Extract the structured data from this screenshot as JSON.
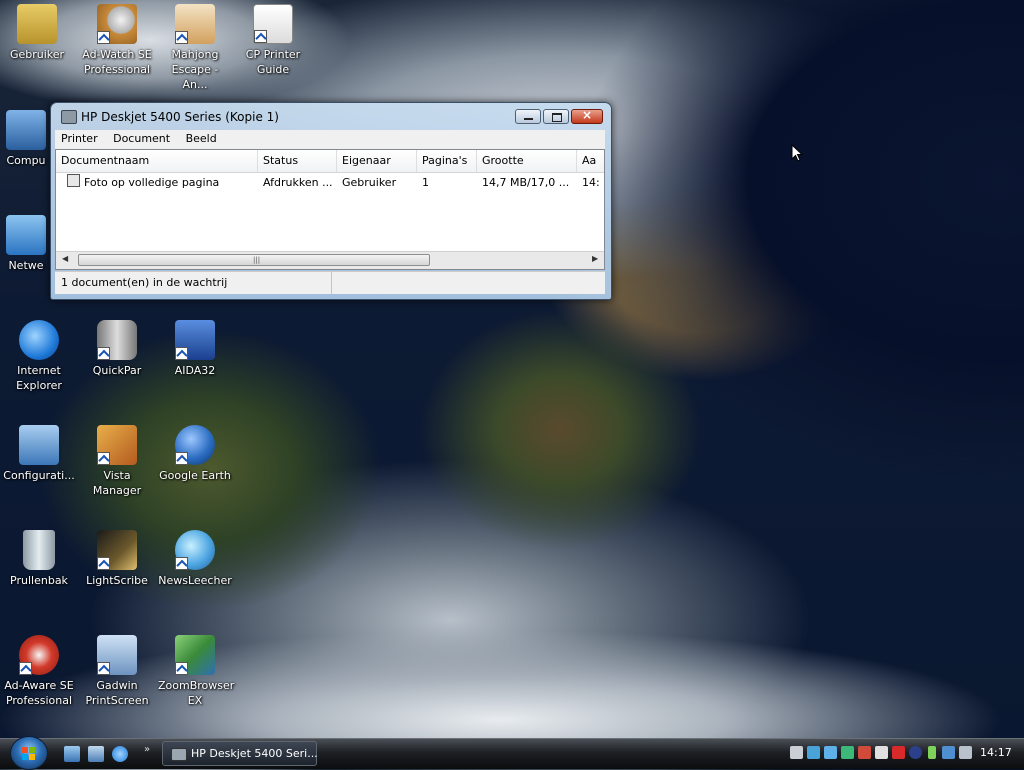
{
  "desktop": {
    "icons": [
      {
        "id": "gebruiker",
        "label": "Gebruiker",
        "color": "#d7b74a",
        "shortcut": false
      },
      {
        "id": "adwatch",
        "label": "Ad-Watch SE Professional",
        "color": "#c98b3a",
        "shortcut": true
      },
      {
        "id": "mahjong",
        "label": "Mahjong Escape - An...",
        "color": "#b8482f",
        "shortcut": true
      },
      {
        "id": "cpprinter",
        "label": "CP Printer Guide",
        "color": "#e6e6e6",
        "shortcut": true
      },
      {
        "id": "computer",
        "label": "Compu",
        "color": "#3f7fc9",
        "shortcut": false
      },
      {
        "id": "network",
        "label": "Netwe",
        "color": "#3a8bd6",
        "shortcut": false
      },
      {
        "id": "ie",
        "label": "Internet Explorer",
        "color": "#1f7ad8",
        "shortcut": false
      },
      {
        "id": "quickpar",
        "label": "QuickPar",
        "color": "#9ea4aa",
        "shortcut": true
      },
      {
        "id": "aida32",
        "label": "AIDA32",
        "color": "#2857b8",
        "shortcut": true
      },
      {
        "id": "config",
        "label": "Configurati...",
        "color": "#4e8ecf",
        "shortcut": false
      },
      {
        "id": "vista",
        "label": "Vista Manager",
        "color": "#d9892d",
        "shortcut": true
      },
      {
        "id": "gearth",
        "label": "Google Earth",
        "color": "#2b6dc2",
        "shortcut": true
      },
      {
        "id": "recycle",
        "label": "Prullenbak",
        "color": "#b4c2cc",
        "shortcut": false
      },
      {
        "id": "lightscribe",
        "label": "LightScribe",
        "color": "#6d5a2c",
        "shortcut": true
      },
      {
        "id": "newsleecher",
        "label": "NewsLeecher",
        "color": "#4ea6e2",
        "shortcut": true
      },
      {
        "id": "adaware",
        "label": "Ad-Aware SE Professional",
        "color": "#d23a2a",
        "shortcut": true
      },
      {
        "id": "gadwin",
        "label": "Gadwin PrintScreen",
        "color": "#7ea6d4",
        "shortcut": true
      },
      {
        "id": "zoombrowser",
        "label": "ZoomBrowser EX",
        "color": "#4fa04a",
        "shortcut": true
      }
    ]
  },
  "window": {
    "title": "HP Deskjet 5400 Series (Kopie 1)",
    "menu": [
      "Printer",
      "Document",
      "Beeld"
    ],
    "columns": [
      "Documentnaam",
      "Status",
      "Eigenaar",
      "Pagina's",
      "Grootte",
      "Aa"
    ],
    "rows": [
      {
        "name": "Foto op volledige pagina",
        "status": "Afdrukken ...",
        "owner": "Gebruiker",
        "pages": "1",
        "size": "14,7 MB/17,0 ...",
        "extra": "14:"
      }
    ],
    "status_text": "1 document(en) in de wachtrij",
    "close_glyph": "×"
  },
  "taskbar": {
    "task_label": "HP Deskjet 5400 Seri...",
    "more_glyph": "»",
    "clock": "14:17"
  }
}
